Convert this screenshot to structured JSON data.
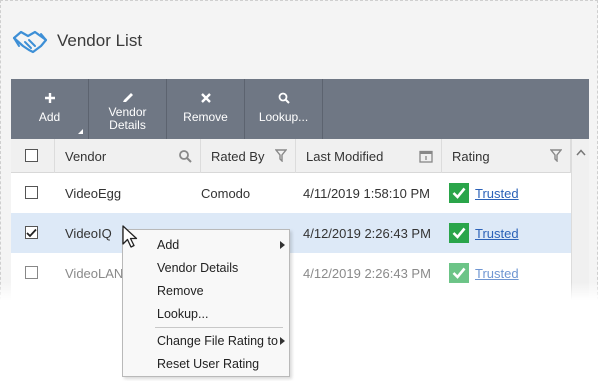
{
  "header": {
    "title": "Vendor List",
    "icon": "handshake-icon"
  },
  "toolbar": {
    "add": {
      "label": "Add",
      "icon": "plus-icon"
    },
    "details": {
      "line1": "Vendor",
      "line2": "Details",
      "icon": "pen-icon"
    },
    "remove": {
      "label": "Remove",
      "icon": "x-icon"
    },
    "lookup": {
      "label": "Lookup...",
      "icon": "search-icon"
    }
  },
  "grid": {
    "columns": {
      "vendor": "Vendor",
      "rated_by": "Rated By",
      "last_modified": "Last Modified",
      "rating": "Rating"
    },
    "rows": [
      {
        "vendor": "VideoEgg",
        "rated_by": "Comodo",
        "last_modified": "4/11/2019 1:58:10 PM",
        "rating": "Trusted",
        "checked": false
      },
      {
        "vendor": "VideoIQ",
        "rated_by": "",
        "last_modified": "4/12/2019 2:26:43 PM",
        "rating": "Trusted",
        "checked": true
      },
      {
        "vendor": "VideoLAN",
        "rated_by": "",
        "last_modified": "4/12/2019 2:26:43 PM",
        "rating": "Trusted",
        "checked": false
      }
    ]
  },
  "context_menu": {
    "items": [
      "Add",
      "Vendor Details",
      "Remove",
      "Lookup...",
      "Change File Rating to",
      "Reset User Rating"
    ]
  },
  "colors": {
    "toolbar": "#6f7784",
    "trusted": "#2aa54a",
    "link": "#2b62b8",
    "selected_row": "#dde9f7",
    "accent_icon": "#3d8fd6"
  }
}
